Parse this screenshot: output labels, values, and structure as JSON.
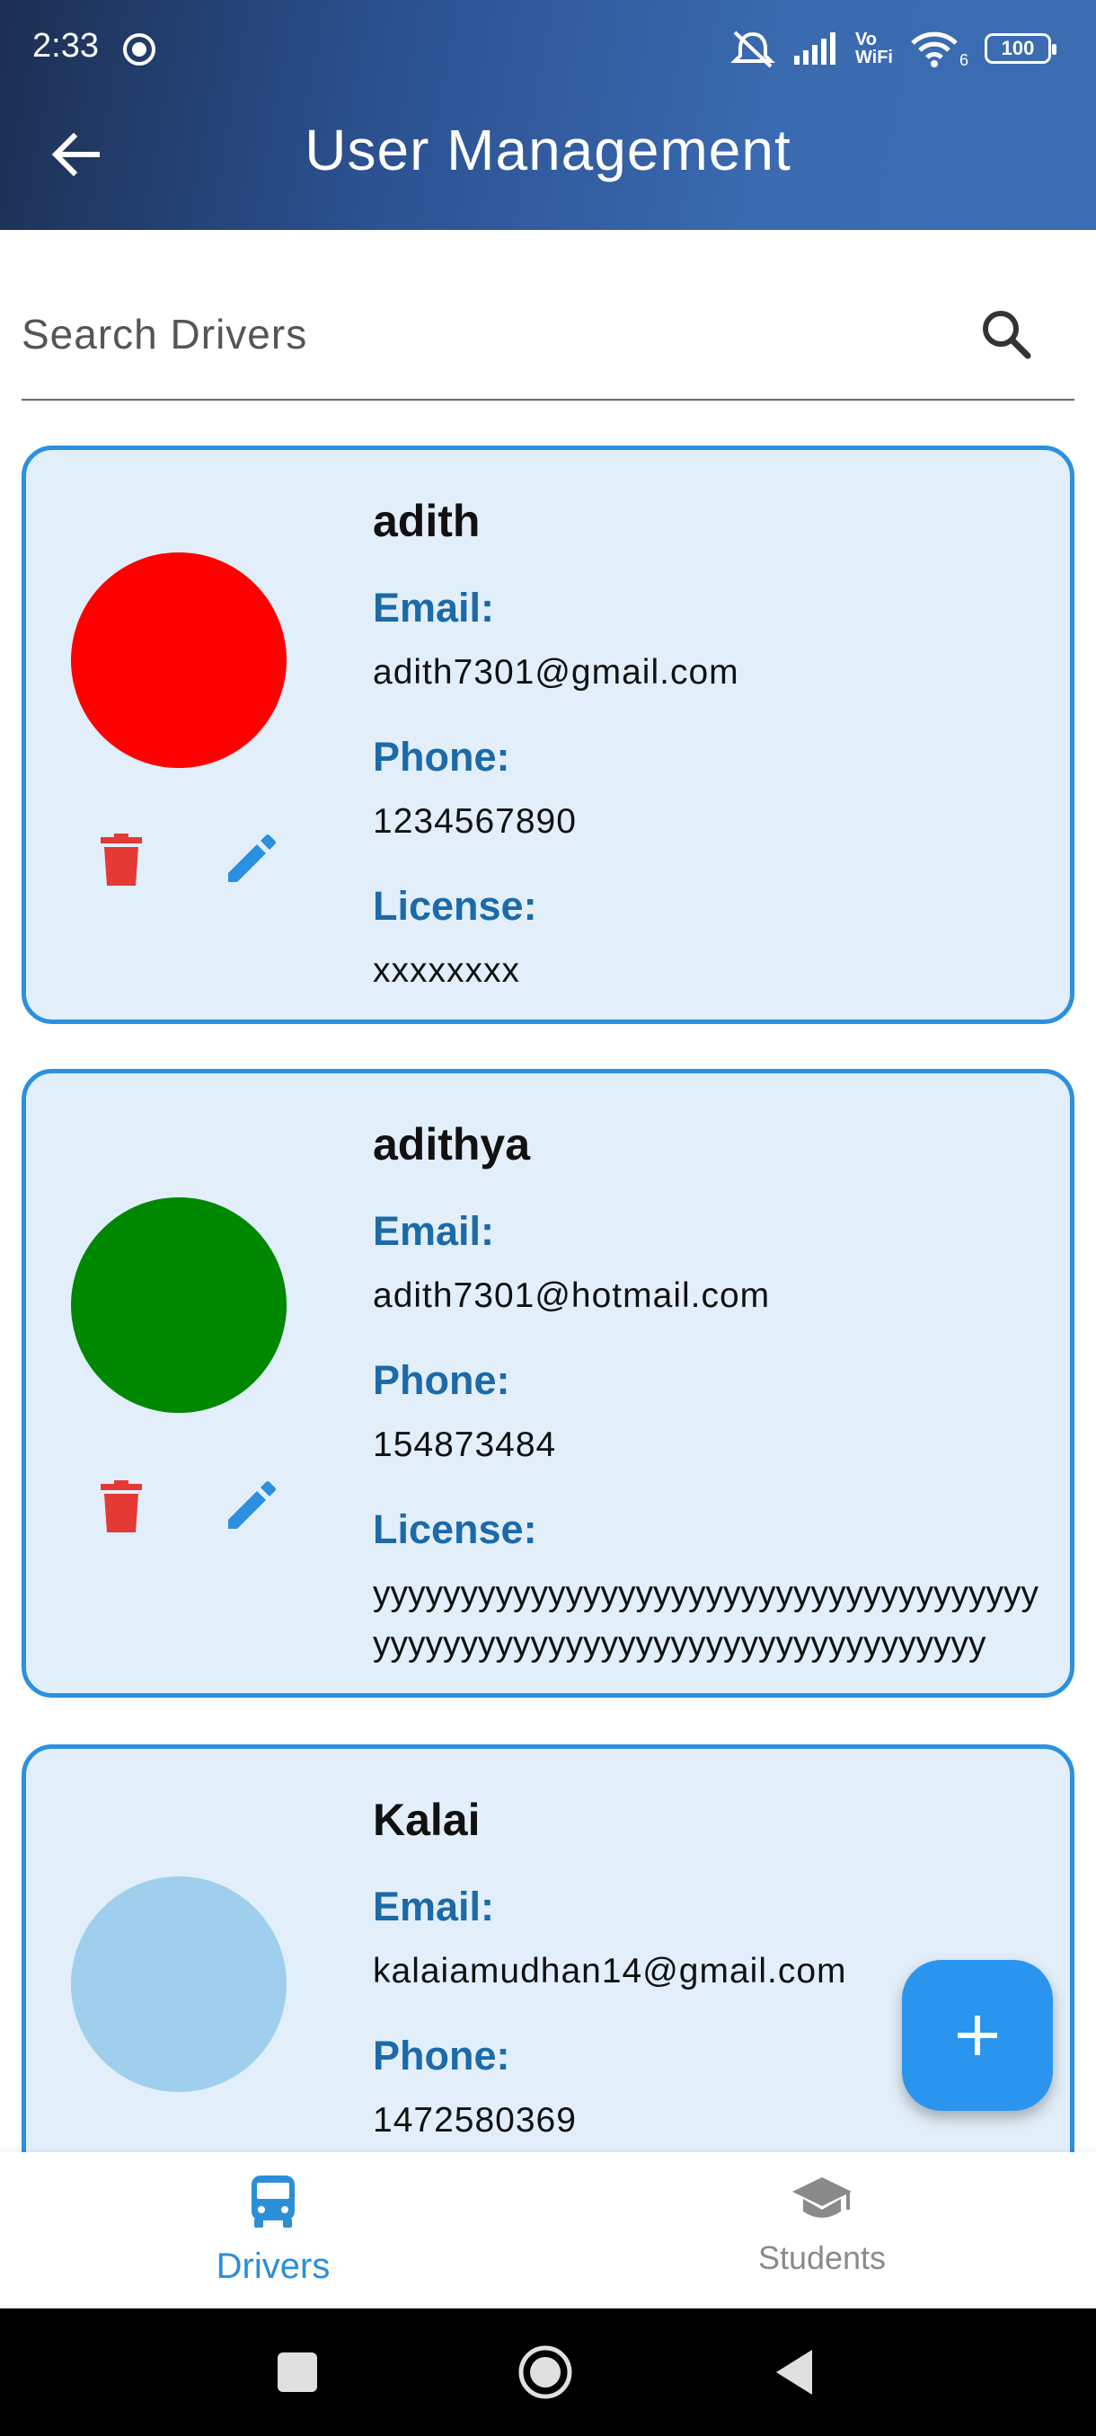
{
  "status_bar": {
    "time": "2:33",
    "battery": "100",
    "network_label_top": "Vo",
    "network_label_bottom": "WiFi",
    "wifi_suffix": "6"
  },
  "app_bar": {
    "title": "User Management",
    "back_icon": "arrow-left-icon"
  },
  "search": {
    "placeholder": "Search Drivers",
    "value": "",
    "icon": "search-icon"
  },
  "labels": {
    "email": "Email:",
    "phone": "Phone:",
    "license": "License:"
  },
  "drivers": [
    {
      "name": "adith",
      "email": "adith7301@gmail.com",
      "phone": "1234567890",
      "license": "xxxxxxxx",
      "avatar_color": "#ff0000"
    },
    {
      "name": "adithya",
      "email": "adith7301@hotmail.com",
      "phone": "154873484",
      "license": "yyyyyyyyyyyyyyyyyyyyyyyyyyyyyyyyyyyyyyyyyyyyyyyyyyyyyyyyyyyyyyyyyyyyyyyyy",
      "avatar_color": "#008800"
    },
    {
      "name": "Kalai",
      "email": "kalaiamudhan14@gmail.com",
      "phone": "1472580369",
      "avatar_color": "#9fcfec"
    }
  ],
  "fab": {
    "icon": "plus-icon"
  },
  "bottom_nav": {
    "items": [
      {
        "label": "Drivers",
        "icon": "bus-icon",
        "active": true
      },
      {
        "label": "Students",
        "icon": "graduation-cap-icon",
        "active": false
      }
    ]
  },
  "colors": {
    "accent": "#2b90e0",
    "card_background": "#e2effa",
    "label_blue": "#1c6aa8",
    "delete_red": "#e53935",
    "header_dark": "#1c2f52",
    "header_light": "#3c6cb3"
  }
}
